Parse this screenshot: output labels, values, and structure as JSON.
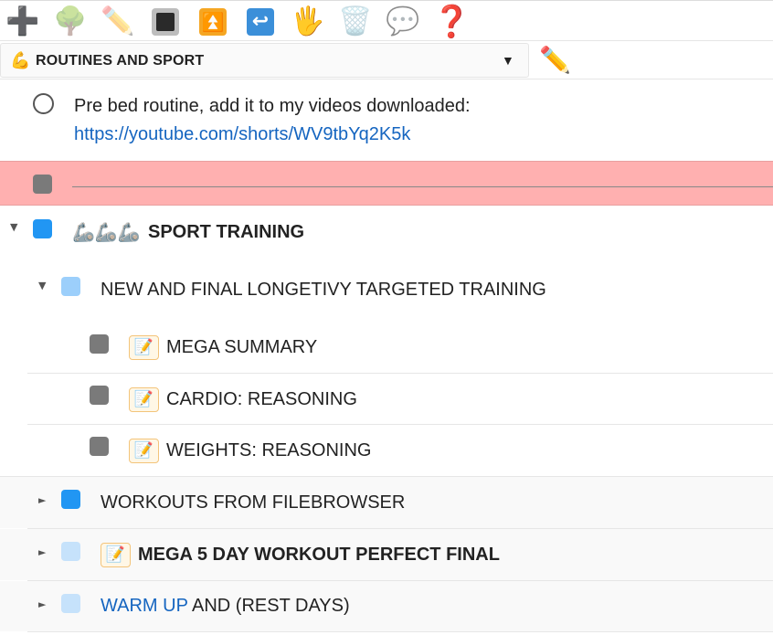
{
  "toolbar": {
    "add_icon": "➕",
    "tree_icon": "🌳",
    "pencil_icon": "✏️",
    "hand_icon": "🖐",
    "trash_icon": "🗑️",
    "comment_icon": "💬",
    "help_icon": "❓",
    "up_icon": "⏫",
    "back_icon": "↩"
  },
  "selector": {
    "icon": "💪",
    "label": "ROUTINES AND SPORT",
    "caret": "▼",
    "edit_icon": "✏️"
  },
  "items": {
    "pre_bed": {
      "line1": "Pre bed routine, add it to my videos downloaded:",
      "link": "https://youtube.com/shorts/WV9tbYq2K5k"
    },
    "sport_training": {
      "prefix_icons": "🦾🦾🦾",
      "label": "SPORT TRAINING",
      "toggle": "▼"
    },
    "longevity": {
      "label": "NEW AND FINAL LONGETIVY TARGETED TRAINING",
      "toggle": "▼"
    },
    "mega_summary": {
      "memo": "📝",
      "label": "MEGA SUMMARY"
    },
    "cardio": {
      "memo": "📝",
      "label": "CARDIO: REASONING"
    },
    "weights": {
      "memo": "📝",
      "label": "WEIGHTS: REASONING"
    },
    "workouts_fb": {
      "label": "WORKOUTS FROM FILEBROWSER",
      "toggle": "►"
    },
    "mega5": {
      "memo": "📝",
      "label": "MEGA 5 DAY WORKOUT PERFECT FINAL",
      "toggle": "►"
    },
    "warmup": {
      "link": "WARM UP",
      "rest": " AND (REST DAYS)",
      "toggle": "►"
    }
  },
  "colors": {
    "selected_row": "#ffb0b0",
    "check_gray": "#7a7a7a",
    "check_blue": "#2196f3",
    "check_light_blue": "#9ccffb",
    "check_lighter_blue": "#c6e2fb",
    "link": "#1565c0"
  }
}
